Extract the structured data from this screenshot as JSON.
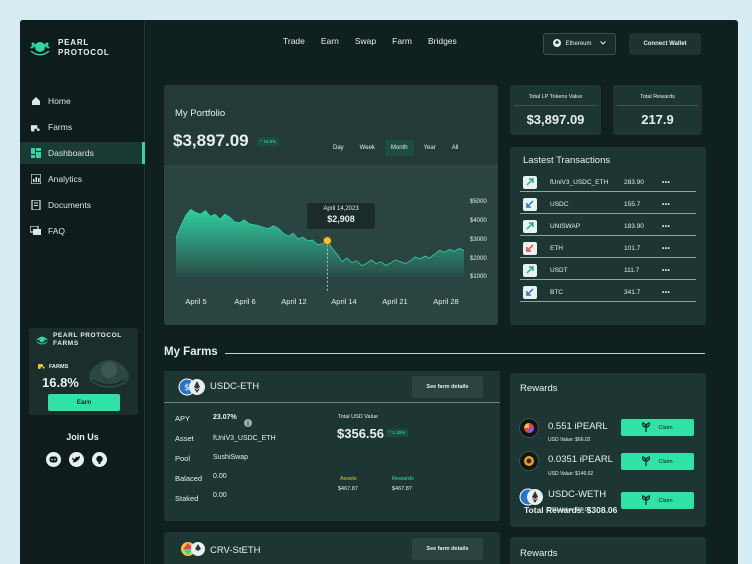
{
  "brand": {
    "line1": "PEARL",
    "line2": "PROTOCOL"
  },
  "sidebar": {
    "items": [
      {
        "label": "Home",
        "icon": "home-icon"
      },
      {
        "label": "Farms",
        "icon": "tractor-icon"
      },
      {
        "label": "Dashboards",
        "icon": "dashboard-icon",
        "active": true
      },
      {
        "label": "Analytics",
        "icon": "analytics-icon"
      },
      {
        "label": "Documents",
        "icon": "documents-icon"
      },
      {
        "label": "FAQ",
        "icon": "faq-icon"
      }
    ],
    "promo": {
      "title1": "PEARL PROTOCOL",
      "title2": "FARMS",
      "farms_label": "FARMS",
      "pct": "16.8%",
      "button": "Earn"
    },
    "join": "Join Us",
    "socials": [
      "discord-icon",
      "twitter-icon",
      "github-icon"
    ]
  },
  "topnav": {
    "items": [
      "Trade",
      "Earn",
      "Swap",
      "Farm",
      "Bridges"
    ]
  },
  "network": {
    "label": "Ethereum"
  },
  "connect": {
    "label": "Connect Wallet"
  },
  "portfolio": {
    "title": "My Portfolio",
    "value": "$3,897.09",
    "badge": "15.8%",
    "periods": [
      "Day",
      "Week",
      "Month",
      "Year",
      "All"
    ],
    "active_period": "Month",
    "tooltip_date": "April 14,2023",
    "tooltip_value": "$2,908"
  },
  "chart_data": {
    "type": "area",
    "x_labels": [
      "April 5",
      "April 6",
      "April 12",
      "April 14",
      "April 21",
      "April 28"
    ],
    "y_ticks": [
      "$5000",
      "$4000",
      "$3000",
      "$2000",
      "$1000"
    ],
    "ylim": [
      1000,
      5000
    ],
    "series": [
      {
        "values": [
          3050,
          3700,
          4250,
          4550,
          4400,
          4300,
          4500,
          4200,
          4300,
          4050,
          4300,
          4150,
          3900,
          3850,
          4000,
          3800,
          3750,
          3700,
          3600,
          3550,
          3700,
          3550,
          3300,
          3150,
          3300,
          3000,
          3100,
          2900,
          2950,
          2700,
          2750,
          2908,
          2500,
          2200,
          1800,
          2000,
          1750,
          1850,
          1600,
          1700,
          1900,
          1700,
          1800,
          1600,
          1750,
          1900,
          1800,
          1700,
          1850,
          2050,
          1950,
          2100,
          2000,
          2200,
          2400,
          2300,
          2450,
          2350,
          2500,
          2400
        ]
      }
    ],
    "highlight_index": 31,
    "color": "#2fd6a4"
  },
  "stats": [
    {
      "label": "Total LP Tokens Value",
      "value": "$3,897.09"
    },
    {
      "label": "Total Rewards",
      "value": "217.9"
    }
  ],
  "transactions": {
    "title": "Lastest Transactions",
    "rows": [
      {
        "name": "fUniV3_USDC_ETH",
        "amount": "283.90",
        "dir": "up"
      },
      {
        "name": "USDC",
        "amount": "155.7",
        "dir": "down"
      },
      {
        "name": "UNISWAP",
        "amount": "183.90",
        "dir": "up"
      },
      {
        "name": "ETH",
        "amount": "101.7",
        "dir": "down-red"
      },
      {
        "name": "USDT",
        "amount": "111.7",
        "dir": "up"
      },
      {
        "name": "BTC",
        "amount": "341.7",
        "dir": "down"
      }
    ],
    "more": "•••"
  },
  "farms": {
    "title": "My Farms",
    "farm1": {
      "name": "USDC-ETH",
      "details": "See farm details",
      "apy_label": "APY",
      "apy": "23.07%",
      "asset_label": "Asset",
      "asset": "fUniV3_USDC_ETH",
      "pool_label": "Pool",
      "pool": "SushiSwap",
      "balanced_label": "Balaced",
      "balanced": "0.00",
      "staked_label": "Staked",
      "staked": "0.00",
      "total_label": "Total USD Value",
      "total": "$356.56",
      "total_badge": "1.15%",
      "assets_label": "Assets",
      "assets": "$467.87",
      "rewards_label": "Rewards",
      "rewards": "$467.87"
    },
    "farm2": {
      "name": "CRV-StETH",
      "details": "See farm details"
    }
  },
  "rewards": {
    "title": "Rewards",
    "items": [
      {
        "name": "0.551 iPEARL",
        "usd": "USD Value: $66.02",
        "claim": "Claim"
      },
      {
        "name": "0.0351 iPEARL",
        "usd": "USD Value: $146.02",
        "claim": "Claim"
      },
      {
        "name": "USDC-WETH",
        "usd": "USD Value: $96.02",
        "claim": "Claim"
      }
    ],
    "total": "Total Rewards: $308.06",
    "title2": "Rewards"
  }
}
